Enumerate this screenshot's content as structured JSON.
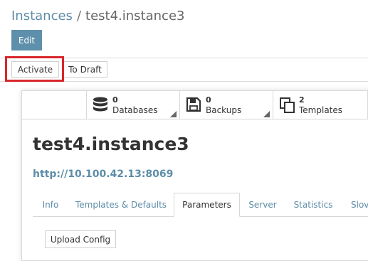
{
  "breadcrumb": {
    "parent": "Instances",
    "separator": "/",
    "current": "test4.instance3"
  },
  "buttons": {
    "edit": "Edit",
    "activate": "Activate",
    "to_draft": "To Draft",
    "upload_config": "Upload Config"
  },
  "smart_buttons": [
    {
      "count": "0",
      "label": "Databases",
      "icon": "database-icon"
    },
    {
      "count": "0",
      "label": "Backups",
      "icon": "floppy-disk-icon"
    },
    {
      "count": "2",
      "label": "Templates",
      "icon": "copy-icon"
    }
  ],
  "record": {
    "title": "test4.instance3",
    "url": "http://10.100.42.13:8069"
  },
  "tabs": [
    {
      "label": "Info",
      "active": false
    },
    {
      "label": "Templates & Defaults",
      "active": false
    },
    {
      "label": "Parameters",
      "active": true
    },
    {
      "label": "Server",
      "active": false
    },
    {
      "label": "Statistics",
      "active": false
    },
    {
      "label": "Slov",
      "active": false
    }
  ],
  "colors": {
    "primary": "#5e8fab",
    "link": "#5d8da8",
    "highlight": "#d9262b"
  }
}
